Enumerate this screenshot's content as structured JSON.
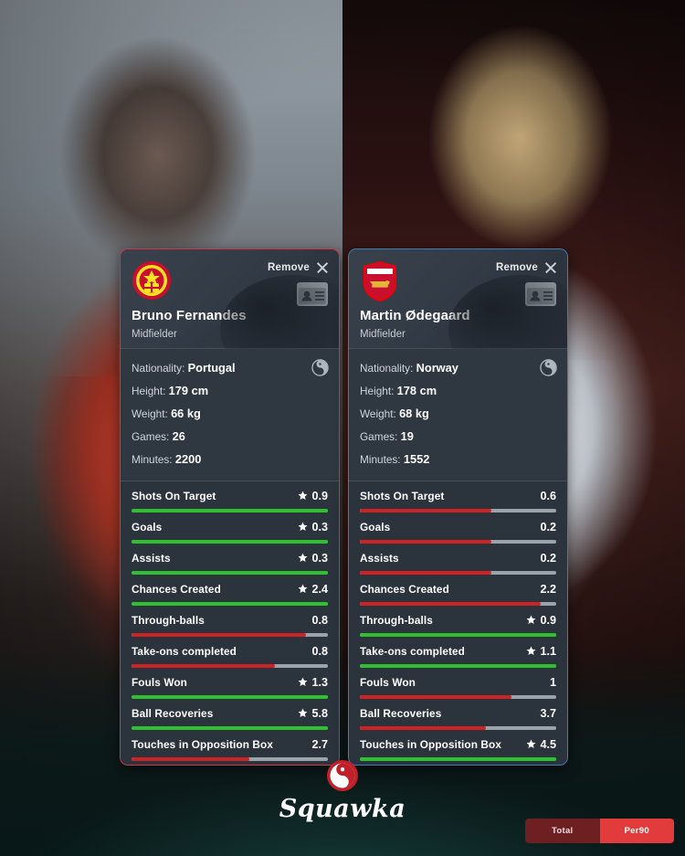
{
  "background": {
    "left_photo_alt": "Bruno Fernandes in Manchester United red kit",
    "right_photo_alt": "Martin Odegaard in Arsenal white and red kit"
  },
  "cards": [
    {
      "accent": "#d4364a",
      "crest_name": "manchester-united-crest",
      "remove_label": "Remove",
      "player_name": "Bruno Fernandes",
      "position": "Midfielder",
      "bio": {
        "nationality_label": "Nationality:",
        "nationality_value": "Portugal",
        "height_label": "Height:",
        "height_value": "179 cm",
        "weight_label": "Weight:",
        "weight_value": "66 kg",
        "games_label": "Games:",
        "games_value": "26",
        "minutes_label": "Minutes:",
        "minutes_value": "2200"
      },
      "stats": [
        {
          "name": "Shots On Target",
          "value": "0.9",
          "winner": true,
          "fill": 100
        },
        {
          "name": "Goals",
          "value": "0.3",
          "winner": true,
          "fill": 100
        },
        {
          "name": "Assists",
          "value": "0.3",
          "winner": true,
          "fill": 100
        },
        {
          "name": "Chances Created",
          "value": "2.4",
          "winner": true,
          "fill": 100
        },
        {
          "name": "Through-balls",
          "value": "0.8",
          "winner": false,
          "fill": 89
        },
        {
          "name": "Take-ons completed",
          "value": "0.8",
          "winner": false,
          "fill": 73
        },
        {
          "name": "Fouls Won",
          "value": "1.3",
          "winner": true,
          "fill": 100
        },
        {
          "name": "Ball Recoveries",
          "value": "5.8",
          "winner": true,
          "fill": 100
        },
        {
          "name": "Touches in Opposition Box",
          "value": "2.7",
          "winner": false,
          "fill": 60
        }
      ]
    },
    {
      "accent": "#3f7fb8",
      "crest_name": "arsenal-crest",
      "remove_label": "Remove",
      "player_name": "Martin Ødegaard",
      "position": "Midfielder",
      "bio": {
        "nationality_label": "Nationality:",
        "nationality_value": "Norway",
        "height_label": "Height:",
        "height_value": "178 cm",
        "weight_label": "Weight:",
        "weight_value": "68 kg",
        "games_label": "Games:",
        "games_value": "19",
        "minutes_label": "Minutes:",
        "minutes_value": "1552"
      },
      "stats": [
        {
          "name": "Shots On Target",
          "value": "0.6",
          "winner": false,
          "fill": 67
        },
        {
          "name": "Goals",
          "value": "0.2",
          "winner": false,
          "fill": 67
        },
        {
          "name": "Assists",
          "value": "0.2",
          "winner": false,
          "fill": 67
        },
        {
          "name": "Chances Created",
          "value": "2.2",
          "winner": false,
          "fill": 92
        },
        {
          "name": "Through-balls",
          "value": "0.9",
          "winner": true,
          "fill": 100
        },
        {
          "name": "Take-ons completed",
          "value": "1.1",
          "winner": true,
          "fill": 100
        },
        {
          "name": "Fouls Won",
          "value": "1",
          "winner": false,
          "fill": 77
        },
        {
          "name": "Ball Recoveries",
          "value": "3.7",
          "winner": false,
          "fill": 64
        },
        {
          "name": "Touches in Opposition Box",
          "value": "4.5",
          "winner": true,
          "fill": 100
        }
      ]
    }
  ],
  "footer": {
    "brand_name": "Squawka",
    "toggle": {
      "total_label": "Total",
      "per90_label": "Per90",
      "active": "Per90"
    }
  }
}
